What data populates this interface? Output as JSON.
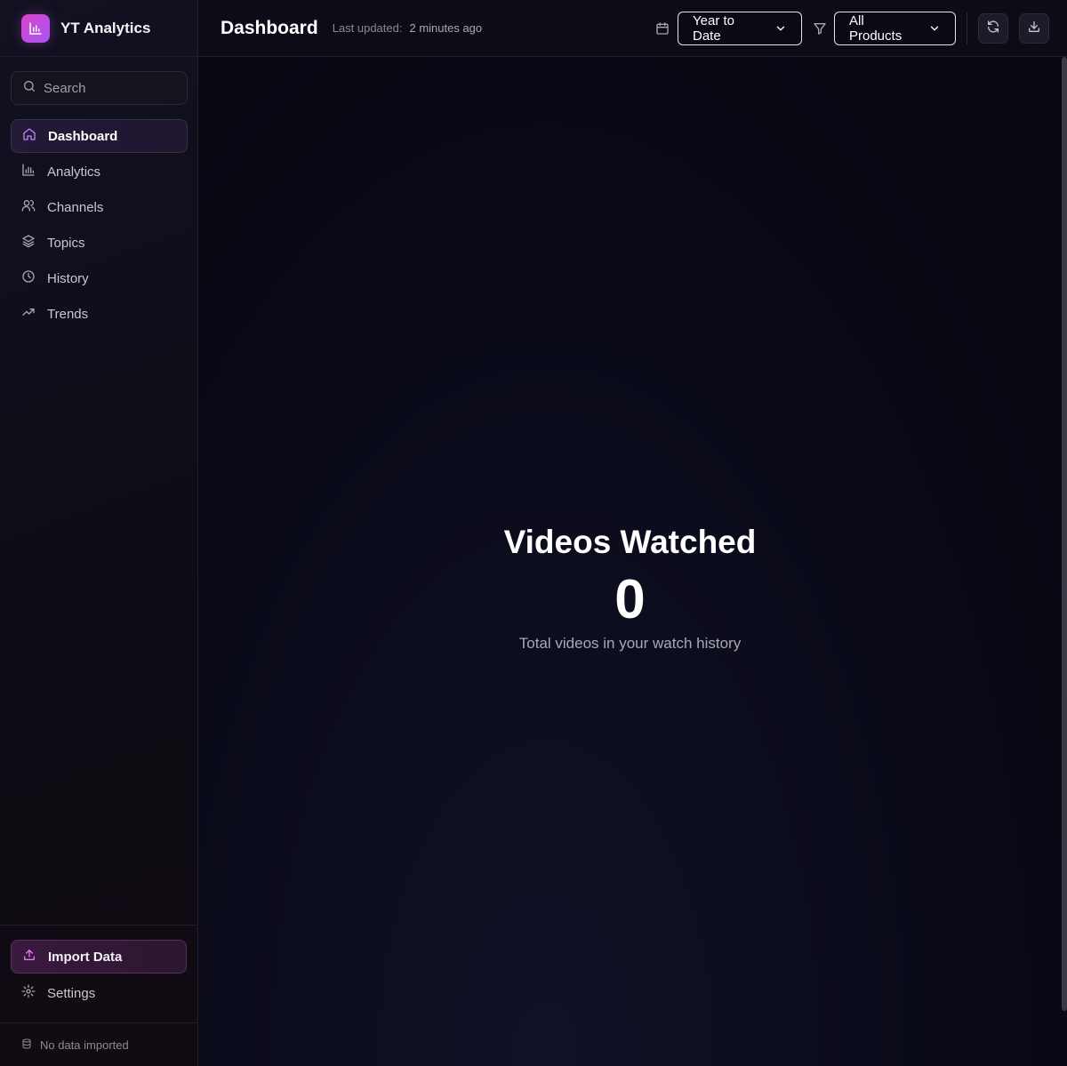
{
  "app": {
    "title": "YT Analytics"
  },
  "search": {
    "placeholder": "Search"
  },
  "nav": {
    "items": [
      {
        "label": "Dashboard",
        "icon": "home-icon",
        "active": true
      },
      {
        "label": "Analytics",
        "icon": "bar-chart-icon"
      },
      {
        "label": "Channels",
        "icon": "users-icon"
      },
      {
        "label": "Topics",
        "icon": "layers-icon"
      },
      {
        "label": "History",
        "icon": "clock-icon"
      },
      {
        "label": "Trends",
        "icon": "trending-up-icon"
      }
    ]
  },
  "sidebar_bottom": {
    "import_label": "Import Data",
    "settings_label": "Settings",
    "status": "No data imported"
  },
  "header": {
    "title": "Dashboard",
    "updated_label": "Last updated:",
    "updated_value": "2 minutes ago",
    "date_range": "Year to Date",
    "product_filter": "All Products"
  },
  "stat": {
    "title": "Videos Watched",
    "value": "0",
    "description": "Total videos in your watch history"
  },
  "colors": {
    "accent": "#d946c8",
    "accent_secondary": "#a855f7",
    "background": "#080814"
  }
}
